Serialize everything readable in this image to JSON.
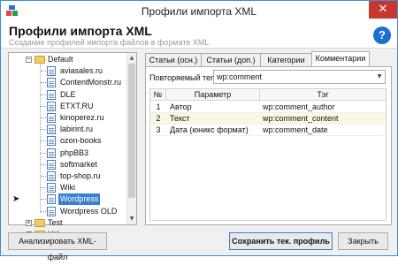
{
  "window": {
    "title": "Профили импорта XML",
    "close_glyph": "✕"
  },
  "header": {
    "title": "Профили импорта XML",
    "subtitle": "Создание профилей импорта файлов в формате XML",
    "help_glyph": "?"
  },
  "tree": {
    "root": "Default",
    "items": [
      "aviasales.ru",
      "ContentMonstr.ru",
      "DLE",
      "ETXT.RU",
      "kinoperez.ru",
      "labirint.ru",
      "ozon-books",
      "phpBB3",
      "softmarket",
      "top-shop.ru",
      "Wiki",
      "Wordpress",
      "Wordpress OLD"
    ],
    "selected": "Wordpress",
    "second_root": "Test",
    "third_root": "Utils",
    "row_arrow": "➤",
    "expander_open": "−",
    "expander_closed": "+"
  },
  "tabs": [
    "Статьи (осн.)",
    "Статьи (доп.)",
    "Категории",
    "Комментарии"
  ],
  "active_tab": "Комментарии",
  "tag": {
    "label": "Повторяемый тег:",
    "value": "wp:comment"
  },
  "grid": {
    "headers": [
      "№",
      "Параметр",
      "Тэг"
    ],
    "rows": [
      [
        "1",
        "Автор",
        "wp:comment_author"
      ],
      [
        "2",
        "Текст",
        "wp:comment_content"
      ],
      [
        "3",
        "Дата (юникс формат)",
        "wp:comment_date"
      ]
    ]
  },
  "buttons": {
    "analyze": "Анализировать XML-файл",
    "save": "Сохранить тек. профиль",
    "close": "Закрыть"
  },
  "colors": {
    "accent": "#3b7fd1",
    "close_red": "#c7372f",
    "help_blue": "#1a6fd0",
    "alt_row": "#fbf7e2"
  }
}
